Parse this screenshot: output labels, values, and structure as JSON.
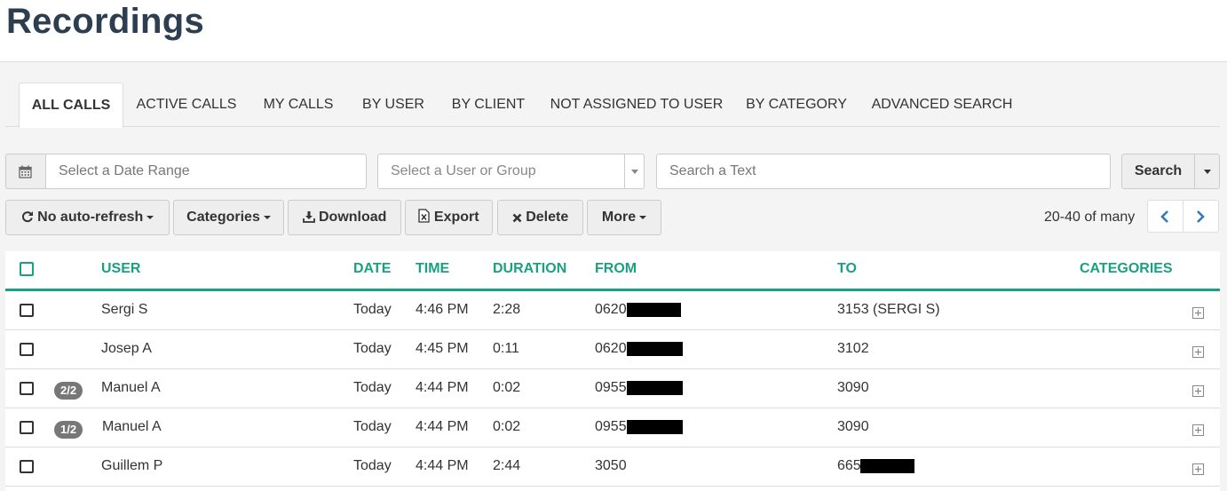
{
  "page": {
    "title": "Recordings"
  },
  "tabs": [
    {
      "label": "ALL CALLS",
      "active": true
    },
    {
      "label": "ACTIVE CALLS"
    },
    {
      "label": "MY CALLS"
    },
    {
      "label": "BY USER"
    },
    {
      "label": "BY CLIENT"
    },
    {
      "label": "NOT ASSIGNED TO USER"
    },
    {
      "label": "BY CATEGORY"
    },
    {
      "label": "ADVANCED SEARCH"
    }
  ],
  "filters": {
    "date_placeholder": "Select a Date Range",
    "user_placeholder": "Select a User or Group",
    "text_placeholder": "Search a Text",
    "search_label": "Search"
  },
  "toolbar": {
    "refresh_label": "No auto-refresh",
    "categories_label": "Categories",
    "download_label": "Download",
    "export_label": "Export",
    "delete_label": "Delete",
    "more_label": "More"
  },
  "pagination": {
    "info": "20-40 of many"
  },
  "table": {
    "headers": [
      "USER",
      "DATE",
      "TIME",
      "DURATION",
      "FROM",
      "TO",
      "CATEGORIES"
    ],
    "rows": [
      {
        "badge": "",
        "user": "Sergi S",
        "date": "Today",
        "time": "4:46 PM",
        "duration": "2:28",
        "from": "0620",
        "to": "3153 (SERGI S)"
      },
      {
        "badge": "",
        "user": "Josep A",
        "date": "Today",
        "time": "4:45 PM",
        "duration": "0:11",
        "from": "0620",
        "to": "3102"
      },
      {
        "badge": "2/2",
        "user": "Manuel A",
        "date": "Today",
        "time": "4:44 PM",
        "duration": "0:02",
        "from": "0955",
        "to": "3090"
      },
      {
        "badge": "1/2",
        "user": "Manuel A",
        "date": "Today",
        "time": "4:44 PM",
        "duration": "0:02",
        "from": "0955",
        "to": "3090"
      },
      {
        "badge": "",
        "user": "Guillem P",
        "date": "Today",
        "time": "4:44 PM",
        "duration": "2:44",
        "from": "3050",
        "to": "665"
      }
    ]
  },
  "colors": {
    "accent": "#1aa082",
    "title": "#2c3e50",
    "link": "#337ab7"
  },
  "icons": [
    "calendar-icon",
    "refresh-icon",
    "download-icon",
    "excel-file-icon",
    "times-icon",
    "chevron-left-icon",
    "chevron-right-icon",
    "plus-square-icon"
  ]
}
